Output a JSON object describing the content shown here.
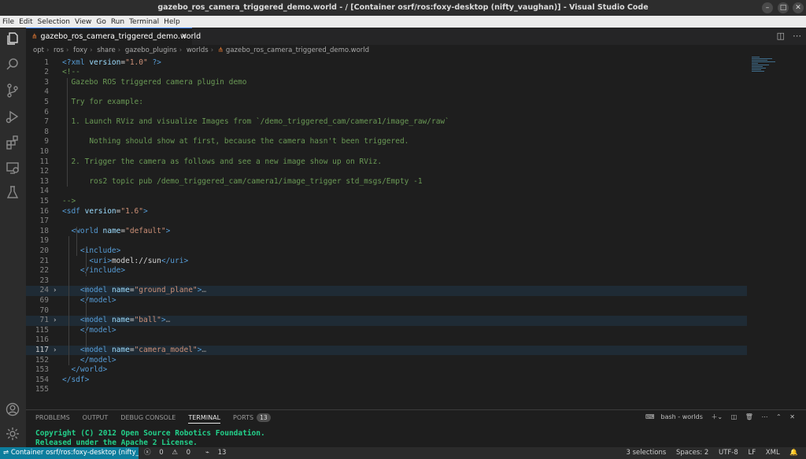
{
  "window": {
    "title": "gazebo_ros_camera_triggered_demo.world - / [Container osrf/ros:foxy-desktop (nifty_vaughan)] - Visual Studio Code"
  },
  "menu": [
    "File",
    "Edit",
    "Selection",
    "View",
    "Go",
    "Run",
    "Terminal",
    "Help"
  ],
  "tab": {
    "label": "gazebo_ros_camera_triggered_demo.world"
  },
  "breadcrumbs": [
    "opt",
    "ros",
    "foxy",
    "share",
    "gazebo_plugins",
    "worlds",
    "gazebo_ros_camera_triggered_demo.world"
  ],
  "editor": {
    "lines": [
      {
        "n": "1",
        "c": [
          [
            "t-tag",
            "<?xml "
          ],
          [
            "t-attr",
            "version"
          ],
          [
            "t-txt",
            "="
          ],
          [
            "t-str",
            "\"1.0\""
          ],
          [
            "t-tag",
            " ?>"
          ]
        ]
      },
      {
        "n": "2",
        "c": [
          [
            "t-cmt",
            "<!--"
          ]
        ]
      },
      {
        "n": "3",
        "c": [
          [
            "t-cmt",
            "  Gazebo ROS triggered camera plugin demo"
          ]
        ]
      },
      {
        "n": "4",
        "c": []
      },
      {
        "n": "5",
        "c": [
          [
            "t-cmt",
            "  Try for example:"
          ]
        ]
      },
      {
        "n": "6",
        "c": []
      },
      {
        "n": "7",
        "c": [
          [
            "t-cmt",
            "  1. Launch RViz and visualize Images from `/demo_triggered_cam/camera1/image_raw/raw`"
          ]
        ]
      },
      {
        "n": "8",
        "c": []
      },
      {
        "n": "9",
        "c": [
          [
            "t-cmt",
            "      Nothing should show at first, because the camera hasn't been triggered."
          ]
        ]
      },
      {
        "n": "10",
        "c": []
      },
      {
        "n": "11",
        "c": [
          [
            "t-cmt",
            "  2. Trigger the camera as follows and see a new image show up on RViz."
          ]
        ]
      },
      {
        "n": "12",
        "c": []
      },
      {
        "n": "13",
        "c": [
          [
            "t-cmt",
            "      ros2 topic pub /demo_triggered_cam/camera1/image_trigger std_msgs/Empty -1"
          ]
        ]
      },
      {
        "n": "14",
        "c": []
      },
      {
        "n": "15",
        "c": [
          [
            "t-cmt",
            "-->"
          ]
        ]
      },
      {
        "n": "16",
        "c": [
          [
            "t-tag",
            "<sdf "
          ],
          [
            "t-attr",
            "version"
          ],
          [
            "t-txt",
            "="
          ],
          [
            "t-str",
            "\"1.6\""
          ],
          [
            "t-tag",
            ">"
          ]
        ]
      },
      {
        "n": "17",
        "c": []
      },
      {
        "n": "18",
        "c": [
          [
            "t-txt",
            "  "
          ],
          [
            "t-tag",
            "<world "
          ],
          [
            "t-attr",
            "name"
          ],
          [
            "t-txt",
            "="
          ],
          [
            "t-str",
            "\"default\""
          ],
          [
            "t-tag",
            ">"
          ]
        ]
      },
      {
        "n": "19",
        "c": []
      },
      {
        "n": "20",
        "c": [
          [
            "t-txt",
            "    "
          ],
          [
            "t-tag",
            "<include>"
          ]
        ]
      },
      {
        "n": "21",
        "c": [
          [
            "t-txt",
            "      "
          ],
          [
            "t-tag",
            "<uri>"
          ],
          [
            "t-txt",
            "model://sun"
          ],
          [
            "t-tag",
            "</uri>"
          ]
        ]
      },
      {
        "n": "22",
        "c": [
          [
            "t-txt",
            "    "
          ],
          [
            "t-tag",
            "</include>"
          ]
        ]
      },
      {
        "n": "23",
        "c": []
      },
      {
        "n": "24",
        "fold": true,
        "hl": true,
        "c": [
          [
            "t-txt",
            "    "
          ],
          [
            "t-tag",
            "<model "
          ],
          [
            "t-attr",
            "name"
          ],
          [
            "t-txt",
            "="
          ],
          [
            "t-str",
            "\"ground_plane\""
          ],
          [
            "t-tag",
            ">"
          ],
          [
            "ellip",
            "…"
          ]
        ]
      },
      {
        "n": "69",
        "c": [
          [
            "t-txt",
            "    "
          ],
          [
            "t-tag",
            "</model>"
          ]
        ]
      },
      {
        "n": "70",
        "c": []
      },
      {
        "n": "71",
        "fold": true,
        "hl": true,
        "c": [
          [
            "t-txt",
            "    "
          ],
          [
            "t-tag",
            "<model "
          ],
          [
            "t-attr",
            "name"
          ],
          [
            "t-txt",
            "="
          ],
          [
            "t-str",
            "\"ball\""
          ],
          [
            "t-tag",
            ">"
          ],
          [
            "ellip",
            "…"
          ]
        ]
      },
      {
        "n": "115",
        "c": [
          [
            "t-txt",
            "    "
          ],
          [
            "t-tag",
            "</model>"
          ]
        ]
      },
      {
        "n": "116",
        "c": []
      },
      {
        "n": "117",
        "fold": true,
        "hl": true,
        "cur": true,
        "c": [
          [
            "t-txt",
            "    "
          ],
          [
            "t-tag",
            "<model "
          ],
          [
            "t-attr",
            "name"
          ],
          [
            "t-txt",
            "="
          ],
          [
            "t-str",
            "\"camera_model\""
          ],
          [
            "t-tag",
            ">"
          ],
          [
            "ellip",
            "…"
          ]
        ]
      },
      {
        "n": "152",
        "c": [
          [
            "t-txt",
            "    "
          ],
          [
            "t-tag",
            "</model>"
          ]
        ]
      },
      {
        "n": "153",
        "c": [
          [
            "t-txt",
            "  "
          ],
          [
            "t-tag",
            "</world>"
          ]
        ]
      },
      {
        "n": "154",
        "c": [
          [
            "t-tag",
            "</sdf>"
          ]
        ]
      },
      {
        "n": "155",
        "c": []
      }
    ]
  },
  "panel": {
    "tabs": [
      "PROBLEMS",
      "OUTPUT",
      "DEBUG CONSOLE",
      "TERMINAL",
      "PORTS"
    ],
    "active_tab": "TERMINAL",
    "ports_count": "13",
    "terminal_name": "bash - worlds",
    "terminal_lines": [
      "Copyright (C) 2012 Open Source Robotics Foundation.",
      "Released under the Apache 2 License."
    ]
  },
  "status": {
    "remote": "Container osrf/ros:foxy-desktop (nifty_v...",
    "errors": "0",
    "warnings": "0",
    "ports": "13",
    "selections": "3 selections",
    "spaces": "Spaces: 2",
    "encoding": "UTF-8",
    "eol": "LF",
    "language": "XML"
  },
  "colors": {
    "accent": "#0c7d9d",
    "terminal_text": "#23d18b"
  }
}
